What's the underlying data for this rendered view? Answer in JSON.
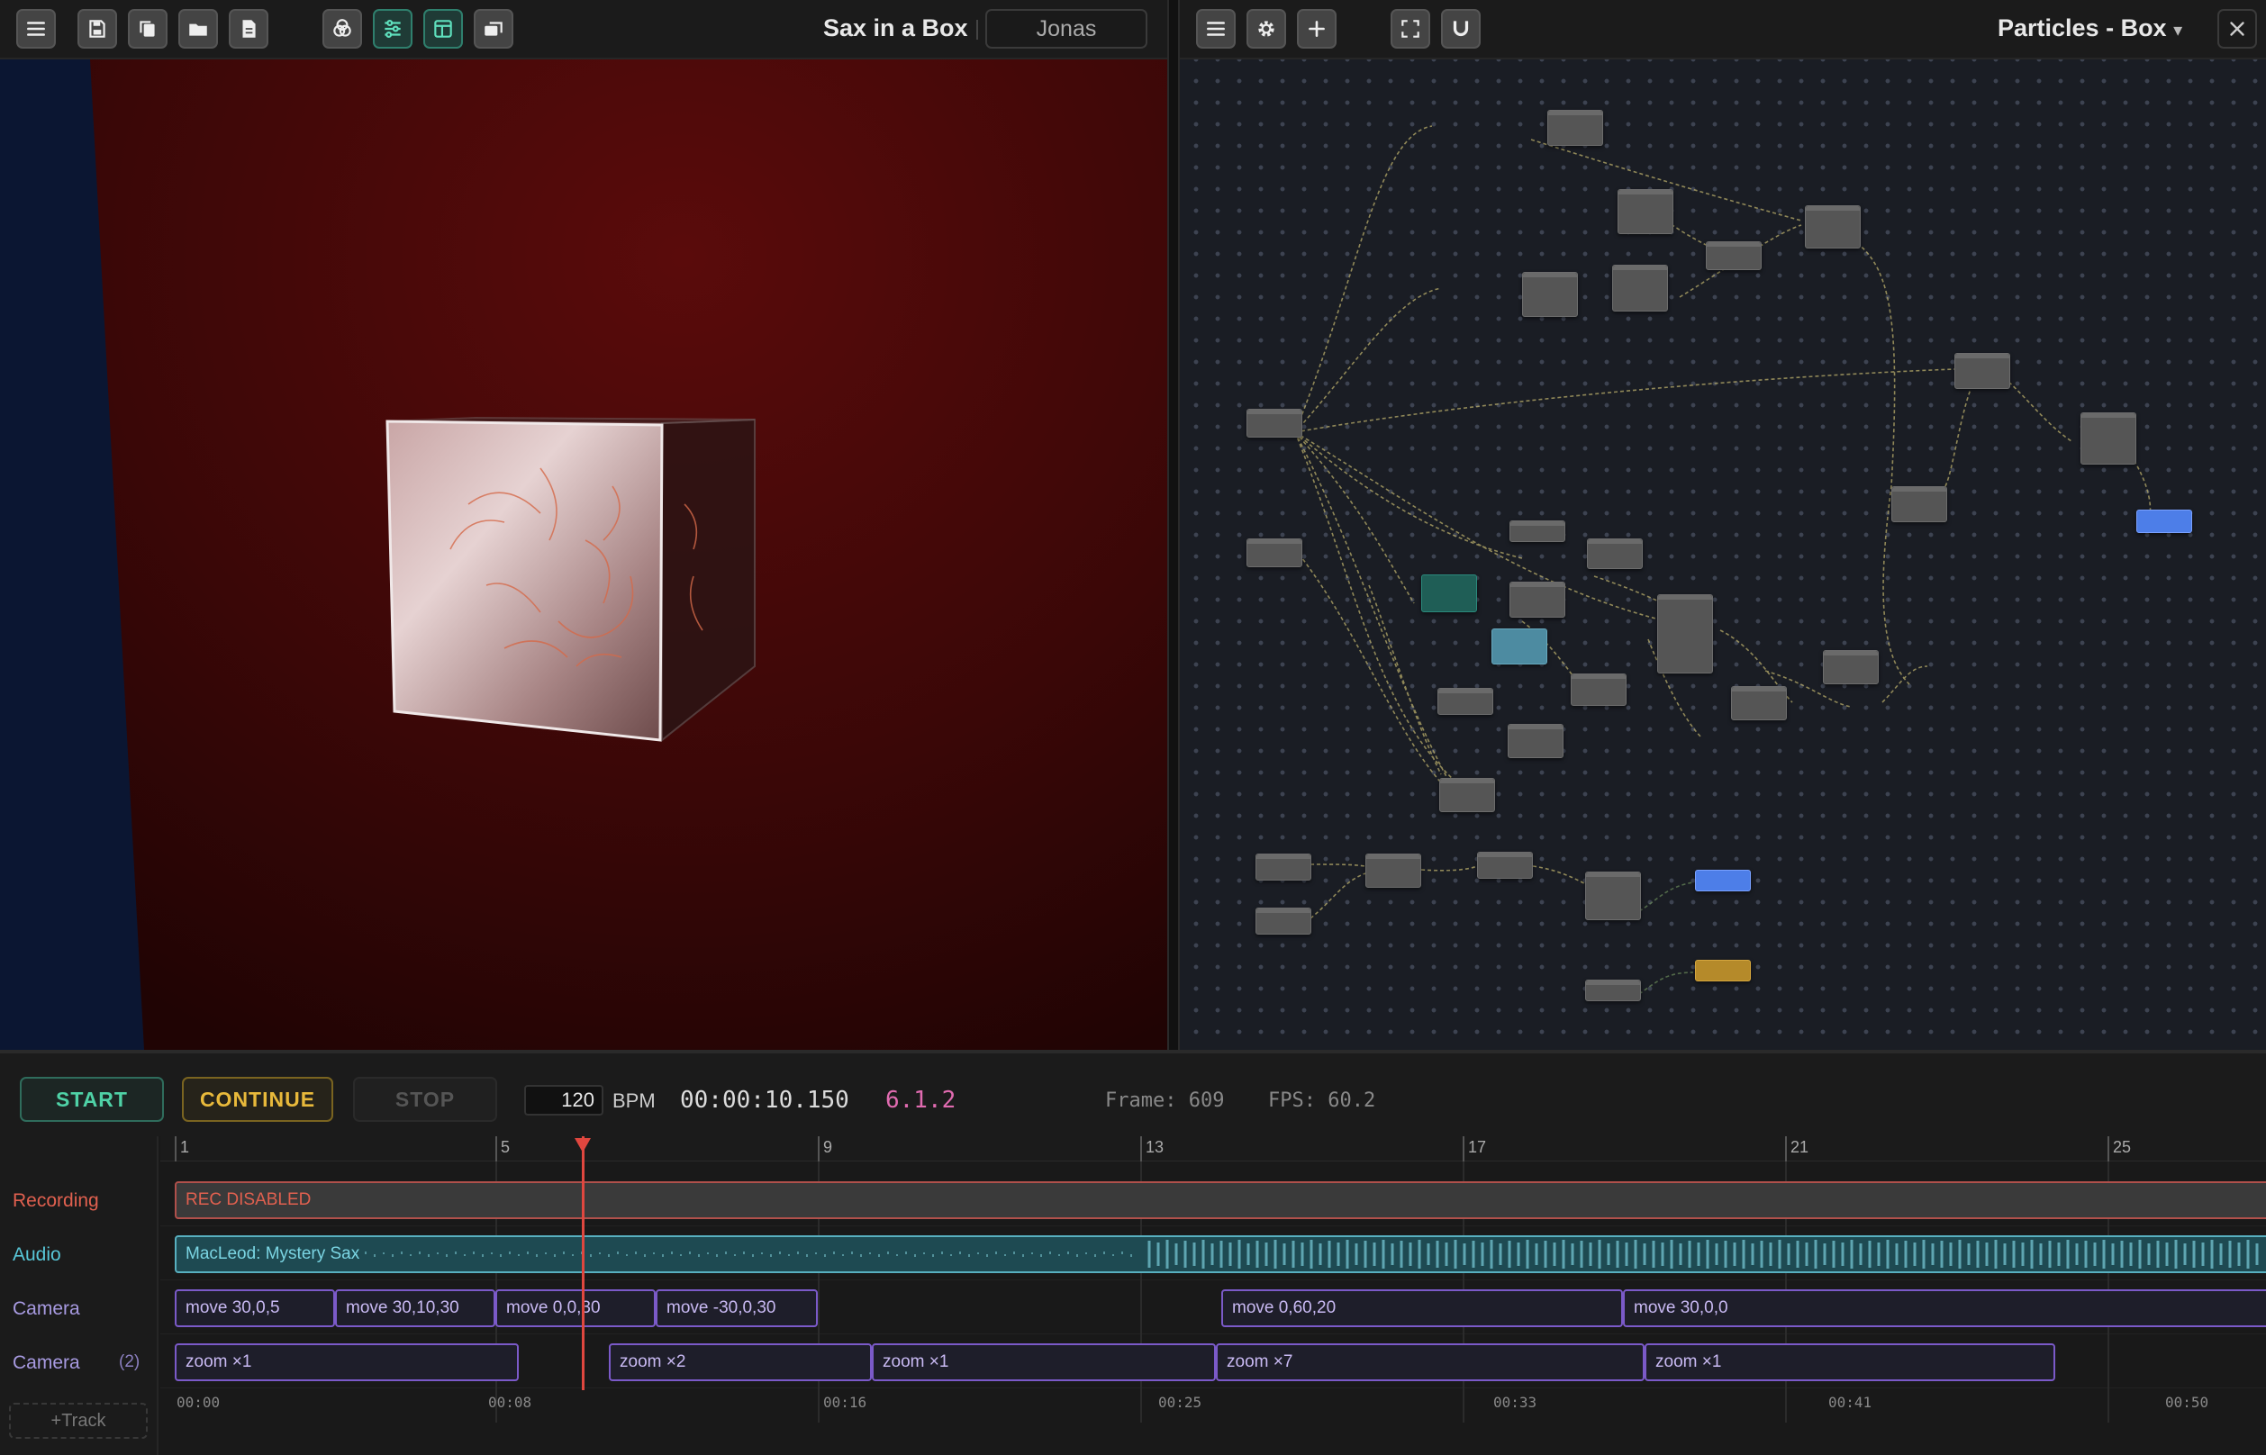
{
  "viewport": {
    "toolbar": {
      "title": "Sax in a Box",
      "user": "Jonas",
      "buttons": [
        {
          "name": "menu-button",
          "icon": "hamburger-icon"
        },
        {
          "name": "save-button",
          "icon": "save-icon"
        },
        {
          "name": "duplicate-button",
          "icon": "copy-icon"
        },
        {
          "name": "open-button",
          "icon": "folder-icon"
        },
        {
          "name": "new-button",
          "icon": "document-icon"
        },
        {
          "name": "inspector-button",
          "icon": "circles-icon"
        },
        {
          "name": "controls-button",
          "icon": "sliders-icon",
          "active": true
        },
        {
          "name": "layout-button",
          "icon": "layout-icon",
          "active": true
        },
        {
          "name": "windows-button",
          "icon": "windows-icon"
        }
      ]
    }
  },
  "graph": {
    "toolbar": {
      "title": "Particles - Box",
      "title_caret": "▾",
      "buttons": [
        {
          "name": "graph-menu-button",
          "icon": "hamburger-icon"
        },
        {
          "name": "graph-settings-button",
          "icon": "gear-icon"
        },
        {
          "name": "add-node-button",
          "icon": "plus-icon"
        },
        {
          "name": "fit-view-button",
          "icon": "fullscreen-icon"
        },
        {
          "name": "snap-button",
          "icon": "magnet-icon"
        },
        {
          "name": "close-graph-button",
          "icon": "close-icon"
        }
      ]
    }
  },
  "transport": {
    "start_label": "START",
    "continue_label": "CONTINUE",
    "stop_label": "STOP",
    "bpm_value": "120",
    "bpm_label": "BPM",
    "time": "00:00:10.150",
    "position": "6.1.2",
    "frame": "Frame: 609",
    "fps": "FPS: 60.2"
  },
  "timeline": {
    "ruler": [
      "1",
      "5",
      "9",
      "13",
      "17",
      "21",
      "25"
    ],
    "timecodes": [
      "00:00",
      "00:08",
      "00:16",
      "00:25",
      "00:33",
      "00:41",
      "00:50"
    ],
    "tracks": [
      {
        "label": "Recording",
        "color": "#e0604f"
      },
      {
        "label": "Audio",
        "color": "#58c7d8"
      },
      {
        "label": "Camera",
        "color": "#a79ae0"
      },
      {
        "label": "Camera",
        "count": "(2)",
        "color": "#a79ae0"
      }
    ],
    "add_track_label": "+Track",
    "recording_clip": "REC DISABLED",
    "audio_clip": "MacLeod: Mystery Sax",
    "camera_clips": [
      "move  30,0,5",
      "move  30,10,30",
      "move  0,0,30",
      "move  -30,0,30",
      "move  0,60,20",
      "move  30,0,0"
    ],
    "camera2_clips": [
      "zoom  ×1",
      "zoom  ×2",
      "zoom  ×1",
      "zoom  ×7",
      "zoom  ×1"
    ]
  },
  "colors": {
    "accent_green": "#4fd1a6",
    "accent_gold": "#e8b93b",
    "accent_pink": "#e06bb0",
    "playhead": "#e0473f",
    "clip_border": "#7b5ac9"
  }
}
